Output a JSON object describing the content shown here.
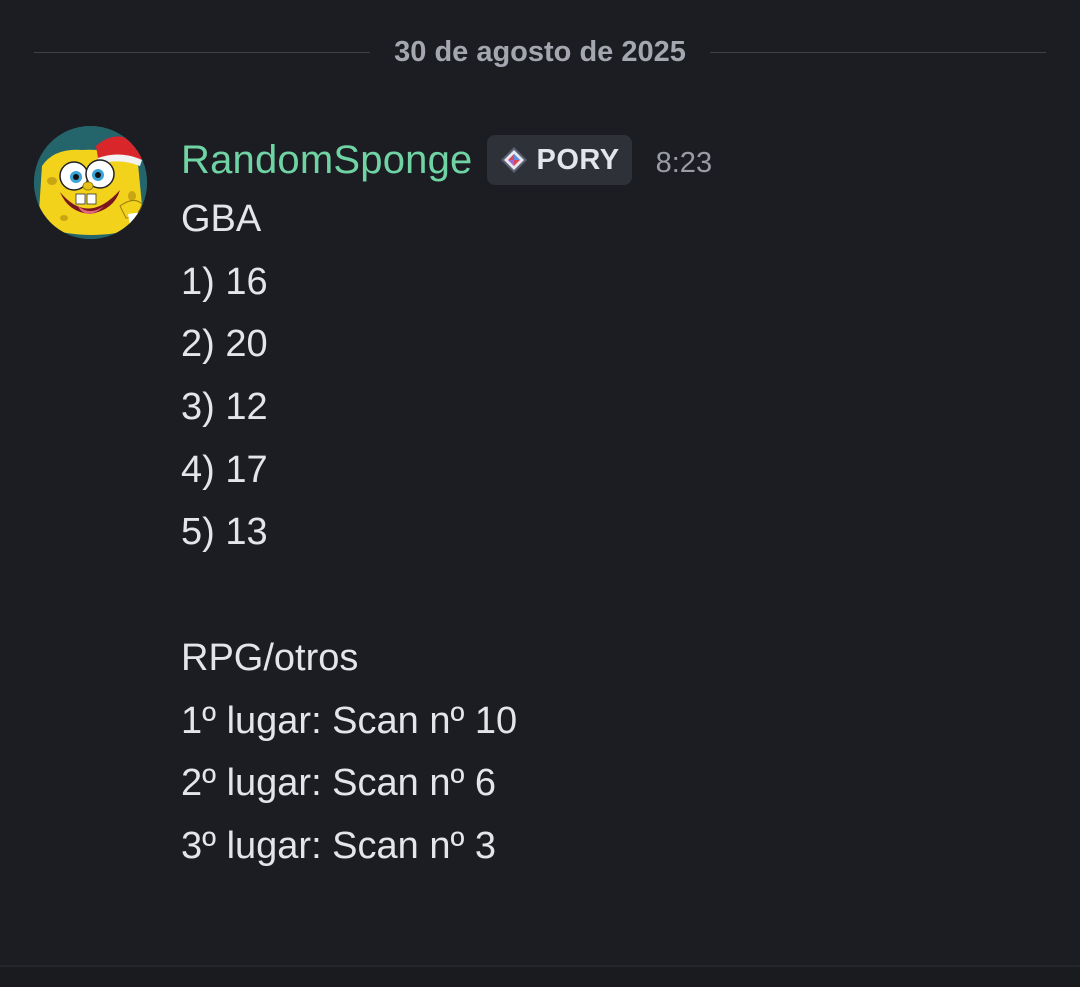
{
  "date_divider": "30 de agosto de 2025",
  "message": {
    "username": "RandomSponge",
    "username_color": "#6fd3a4",
    "tag": {
      "label": "PORY",
      "icon": "pory-diamond-icon"
    },
    "timestamp": "8:23",
    "avatar": "spongebob-avatar",
    "lines": [
      "GBA",
      "1) 16",
      "2) 20",
      "3) 12",
      "4) 17",
      "5) 13",
      "",
      "RPG/otros",
      "1º lugar: Scan nº 10",
      "2º lugar: Scan nº 6",
      "3º lugar: Scan nº 3"
    ]
  }
}
